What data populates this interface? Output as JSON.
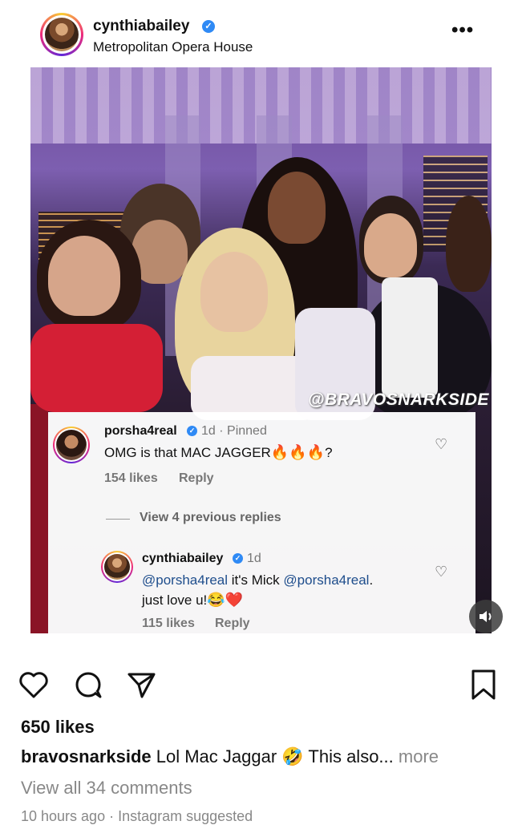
{
  "post": {
    "username": "cynthiabailey",
    "verified": true,
    "location": "Metropolitan Opera House",
    "more_label": "•••",
    "watermark": "@BRAVOSNARKSIDE"
  },
  "comments": {
    "pinned": {
      "username": "porsha4real",
      "time": "1d",
      "separator": "·",
      "pinned_label": "Pinned",
      "text": "OMG is that MAC JAGGER",
      "emojis": "🔥🔥🔥",
      "suffix": "?",
      "likes": "154 likes",
      "reply_label": "Reply"
    },
    "view_previous": "View 4 previous replies",
    "reply": {
      "username": "cynthiabailey",
      "time": "1d",
      "mention1": "@porsha4real",
      "text_mid": " it's Mick ",
      "mention2": "@porsha4real",
      "text_end": ".",
      "line2": "just love u!",
      "emojis": "😂❤️",
      "likes": "115 likes",
      "reply_label": "Reply"
    }
  },
  "actions": {
    "like_icon": "heart-icon",
    "comment_icon": "comment-icon",
    "share_icon": "share-icon",
    "save_icon": "bookmark-icon",
    "sound_icon": "speaker-icon"
  },
  "stats": {
    "likes": "650 likes"
  },
  "caption": {
    "username": "bravosnarkside",
    "text": " Lol Mac Jaggar ",
    "emoji": "🤣",
    "text2": " This also...",
    "more": " more"
  },
  "view_comments": "View all 34 comments",
  "timestamp": "10 hours ago · Instagram suggested",
  "colors": {
    "verified_blue": "#2f8af5",
    "mention_blue": "#1e4d8c",
    "muted_gray": "#888888"
  }
}
